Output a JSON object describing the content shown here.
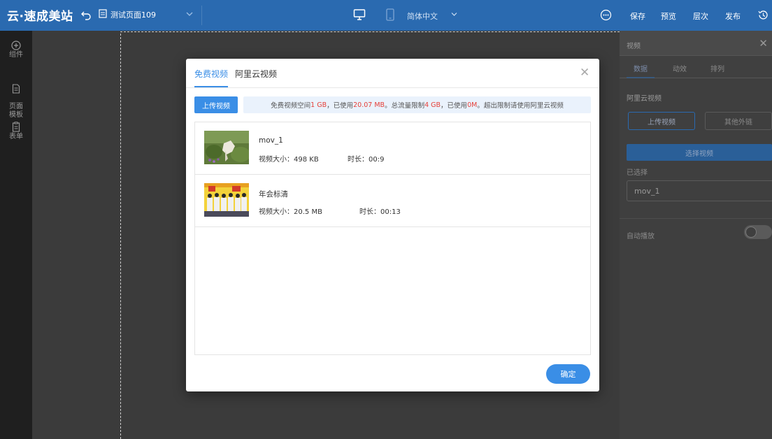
{
  "topbar": {
    "brand": "云·速成美站",
    "page_name": "测试页面109",
    "language": "简体中文",
    "actions": {
      "save": "保存",
      "preview": "预览",
      "layers": "层次",
      "publish": "发布"
    }
  },
  "leftbar": {
    "items": [
      {
        "label": "组件",
        "icon": "plus-circle-icon"
      },
      {
        "label": "页面\n模板",
        "icon": "page-icon"
      },
      {
        "label": "表单",
        "icon": "form-icon"
      }
    ]
  },
  "right_panel": {
    "title": "视频",
    "tabs": [
      "数据",
      "动效",
      "排列"
    ],
    "section_title": "阿里云视频",
    "upload_video": "上传视频",
    "other_link": "其他外链",
    "choose_video": "选择视频",
    "selected_label": "已选择",
    "selected_value": "mov_1",
    "autoplay_label": "自动播放",
    "autoplay_on": false
  },
  "modal": {
    "tabs": [
      "免费视频",
      "阿里云视频"
    ],
    "active_tab": 0,
    "upload_button": "上传视频",
    "info": {
      "p1": "免费视频空间",
      "space": "1 GB",
      "p2": "，已使用",
      "space_used": "20.07 MB",
      "p3": "。总流量限制",
      "traffic": "4 GB",
      "p4": "，已使用",
      "traffic_used": "0M",
      "p5": "。超出限制请使用阿里云视频"
    },
    "videos": [
      {
        "name": "mov_1",
        "size": "视频大小：498 KB",
        "duration": "时长：00:9"
      },
      {
        "name": "年会标清",
        "size": "视频大小：20.5 MB",
        "duration": "时长：00:13"
      }
    ],
    "confirm": "确定"
  }
}
